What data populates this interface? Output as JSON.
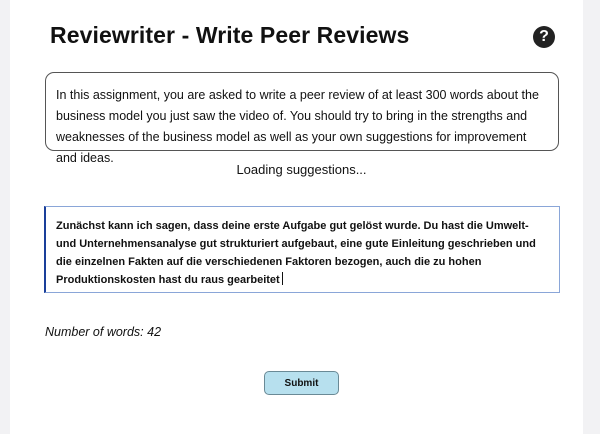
{
  "header": {
    "title": "Reviewriter - Write Peer Reviews",
    "help_glyph": "?"
  },
  "instructions": {
    "text": "In this assignment, you are asked to write a peer review of at least 300 words about the business model you just saw the video of. You should try to bring in the strengths and weaknesses of the business model as well as your own suggestions for improvement and ideas."
  },
  "status": {
    "loading_text": "Loading suggestions..."
  },
  "editor": {
    "value": "Zunächst kann ich sagen, dass deine erste Aufgabe gut gelöst wurde. Du hast die Umwelt- und Unternehmensanalyse gut strukturiert aufgebaut, eine gute Einleitung geschrieben und die einzelnen Fakten auf die verschiedenen Faktoren bezogen, auch die zu hohen Produktionskosten hast du raus gearbeitet"
  },
  "word_count": {
    "text": "Number of words: 42"
  },
  "actions": {
    "submit_label": "Submit"
  },
  "colors": {
    "accent_button": "#b7e0ee",
    "editor_focus_border": "#1a3f9a"
  }
}
